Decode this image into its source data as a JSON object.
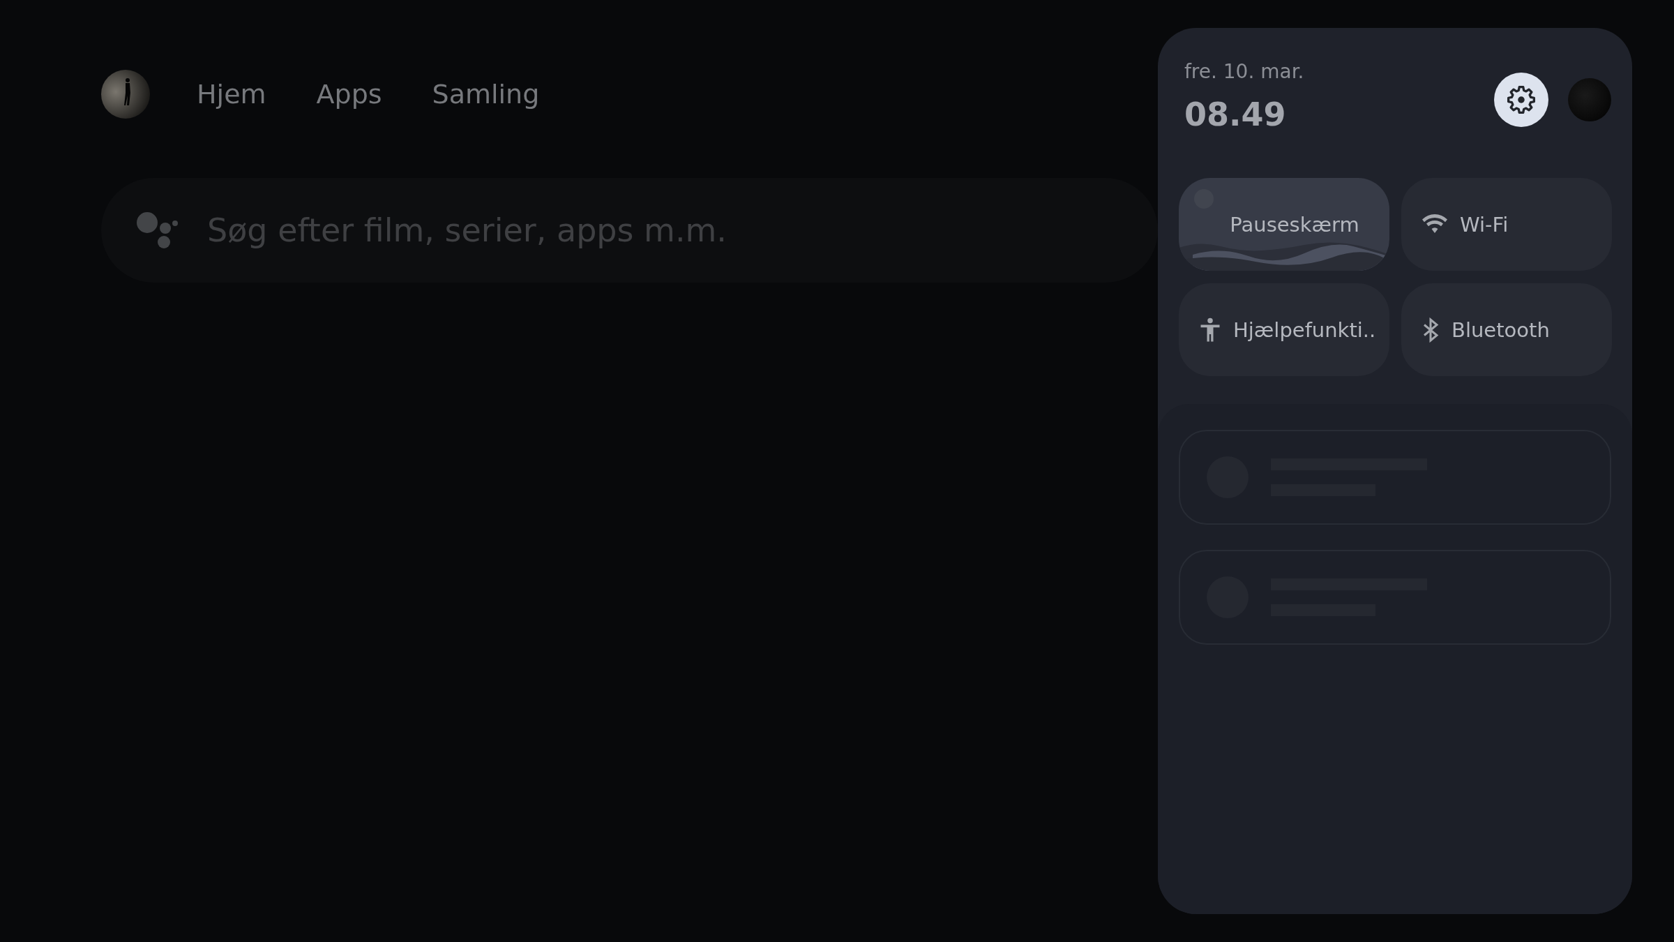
{
  "nav": {
    "items": [
      {
        "label": "Hjem"
      },
      {
        "label": "Apps"
      },
      {
        "label": "Samling"
      }
    ]
  },
  "search": {
    "placeholder": "Søg efter film, serier, apps m.m."
  },
  "panel": {
    "date": "fre. 10. mar.",
    "time": "08.49",
    "tiles": [
      {
        "kind": "screensaver",
        "label": "Pauseskærm",
        "selected": true
      },
      {
        "kind": "wifi",
        "label": "Wi-Fi",
        "selected": false
      },
      {
        "kind": "accessibility",
        "label": "Hjælpefunkti..",
        "selected": false
      },
      {
        "kind": "bluetooth",
        "label": "Bluetooth",
        "selected": false
      }
    ],
    "notifications": [
      {
        "kind": "skeleton"
      },
      {
        "kind": "skeleton"
      }
    ]
  }
}
